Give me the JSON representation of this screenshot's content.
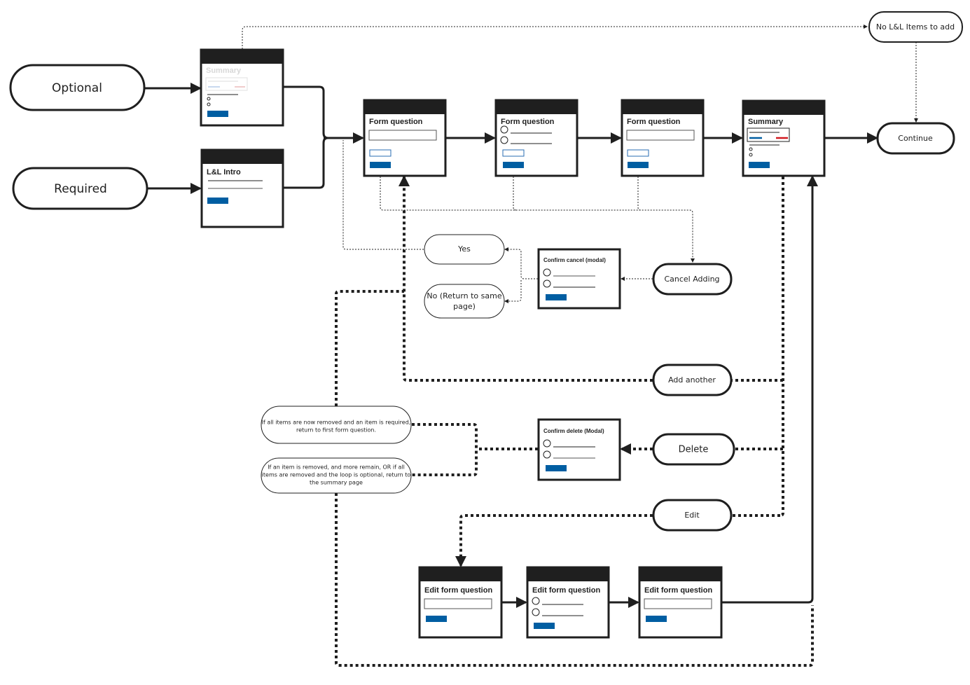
{
  "colors": {
    "ink": "#1f1f1f",
    "primary_button": "#005ea2",
    "outline_button": "#2a6db3",
    "danger": "#d1181f",
    "ghost": "#dcdcdc",
    "background": "#ffffff"
  },
  "entry_points": {
    "optional": "Optional",
    "required": "Required"
  },
  "screens": {
    "summary_ghost": {
      "title": "Summary"
    },
    "intro": {
      "title": "L&L Intro"
    },
    "form_q1": {
      "title": "Form question",
      "type": "text-input"
    },
    "form_q2": {
      "title": "Form question",
      "type": "radio"
    },
    "form_q3": {
      "title": "Form question",
      "type": "text-input"
    },
    "summary": {
      "title": "Summary"
    },
    "confirm_cancel": {
      "title": "Confirm cancel (modal)"
    },
    "confirm_delete": {
      "title": "Confirm delete (Modal)"
    },
    "edit_q1": {
      "title": "Edit form question",
      "type": "text-input"
    },
    "edit_q2": {
      "title": "Edit form question",
      "type": "radio"
    },
    "edit_q3": {
      "title": "Edit form question",
      "type": "text-input"
    }
  },
  "terminals": {
    "no_items": "No L&L Items to add",
    "continue": "Continue",
    "yes": "Yes",
    "no_return_line1": "No (Return to same",
    "no_return_line2": "page)",
    "cancel_adding": "Cancel Adding",
    "add_another": "Add another",
    "delete": "Delete",
    "edit": "Edit"
  },
  "notes": {
    "all_removed_required": [
      "If all items are now removed and an item is required,",
      "return to first form question."
    ],
    "removed_return_summary": [
      "If an item is removed, and more remain, OR if all",
      "items are removed and the loop is optional, return to",
      "the summary page"
    ]
  }
}
